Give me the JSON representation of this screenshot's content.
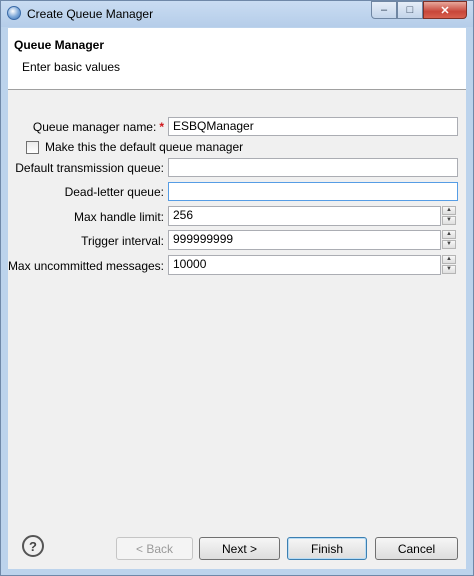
{
  "window": {
    "title": "Create Queue Manager",
    "buttons": {
      "minimize": "–",
      "maximize": "□",
      "close": "✕"
    }
  },
  "header": {
    "title": "Queue Manager",
    "subtitle": "Enter basic values"
  },
  "form": {
    "qm_name": {
      "label": "Queue manager name:",
      "required_marker": "*",
      "value": "ESBQManager"
    },
    "default_qm": {
      "label": "Make this the default queue manager",
      "checked": false
    },
    "transmission_queue": {
      "label": "Default transmission queue:",
      "value": ""
    },
    "dead_letter_queue": {
      "label": "Dead-letter queue:",
      "value": ""
    },
    "max_handle": {
      "label": "Max handle limit:",
      "value": "256"
    },
    "trigger_interval": {
      "label": "Trigger interval:",
      "value": "999999999"
    },
    "max_uncommitted": {
      "label": "Max uncommitted messages:",
      "value": "10000"
    }
  },
  "footer": {
    "help_icon": "?",
    "back": "< Back",
    "next": "Next >",
    "finish": "Finish",
    "cancel": "Cancel"
  },
  "colors": {
    "required": "#d0161b",
    "focus_border": "#569de5",
    "title_bar": "#bcd3ec"
  }
}
